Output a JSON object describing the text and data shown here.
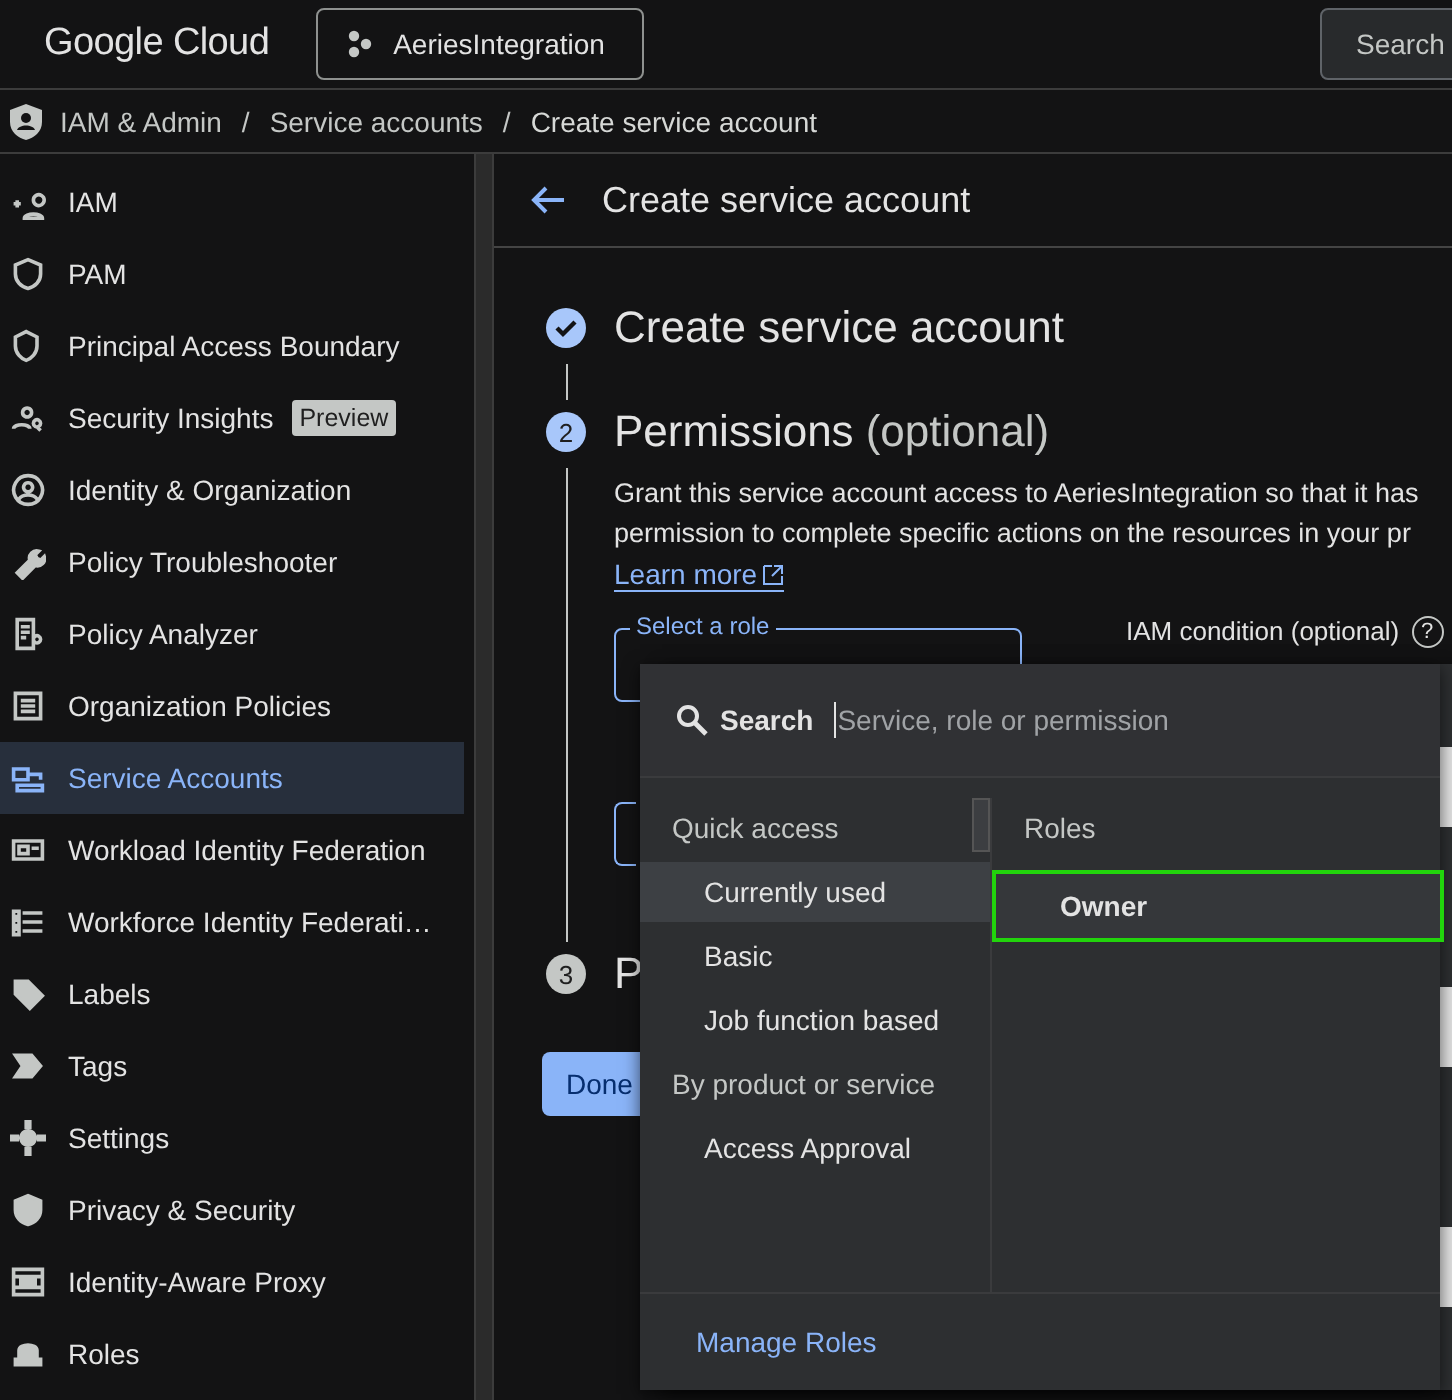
{
  "topbar": {
    "logo": "Google Cloud",
    "project": "AeriesIntegration",
    "search": "Search"
  },
  "breadcrumb": [
    {
      "label": "IAM & Admin",
      "kind": "link"
    },
    {
      "label": "/",
      "kind": "separator"
    },
    {
      "label": "Service accounts",
      "kind": "link"
    },
    {
      "label": "/",
      "kind": "separator"
    },
    {
      "label": "Create service account",
      "kind": "current"
    }
  ],
  "sidebar": {
    "items": [
      {
        "label": "IAM",
        "selected": false
      },
      {
        "label": "PAM",
        "selected": false
      },
      {
        "label": "Principal Access Boundary",
        "selected": false
      },
      {
        "label": "Security Insights",
        "badge": "Preview",
        "selected": false
      },
      {
        "label": "Identity & Organization",
        "selected": false
      },
      {
        "label": "Policy Troubleshooter",
        "selected": false
      },
      {
        "label": "Policy Analyzer",
        "selected": false
      },
      {
        "label": "Organization Policies",
        "selected": false
      },
      {
        "label": "Service Accounts",
        "selected": true
      },
      {
        "label": "Workload Identity Federation",
        "selected": false
      },
      {
        "label": "Workforce Identity Federati…",
        "selected": false
      },
      {
        "label": "Labels",
        "selected": false
      },
      {
        "label": "Tags",
        "selected": false
      },
      {
        "label": "Settings",
        "selected": false
      },
      {
        "label": "Privacy & Security",
        "selected": false
      },
      {
        "label": "Identity-Aware Proxy",
        "selected": false
      },
      {
        "label": "Roles",
        "selected": false
      }
    ]
  },
  "page": {
    "title": "Create service account",
    "steps": [
      {
        "title": "Create service account",
        "done": true
      },
      {
        "marker": "2",
        "title": "Permissions",
        "suffix": "(optional)",
        "done": false,
        "description": [
          "Grant this service account access to AeriesIntegration so that it has",
          "permission to complete specific actions on the resources in your pr"
        ],
        "link": "Learn more",
        "role_field": "Select a role",
        "condition_label": "IAM condition (optional)",
        "help": "?"
      },
      {
        "marker": "3",
        "title": "P",
        "done": false
      }
    ],
    "done_button": "Done"
  },
  "role_menu": {
    "search_label": "Search",
    "search_placeholder": "Service, role or permission",
    "categories": [
      {
        "label": "Quick access",
        "kind": "heading"
      },
      {
        "label": "Currently used",
        "kind": "item",
        "selected": true
      },
      {
        "label": "Basic",
        "kind": "item",
        "selected": false
      },
      {
        "label": "Job function based",
        "kind": "item",
        "selected": false
      },
      {
        "label": "By product or service",
        "kind": "heading"
      },
      {
        "label": "Access Approval",
        "kind": "item",
        "selected": false
      }
    ],
    "roles_heading": "Roles",
    "roles": [
      {
        "label": "Owner",
        "highlighted": true
      }
    ],
    "footer_link": "Manage Roles"
  }
}
